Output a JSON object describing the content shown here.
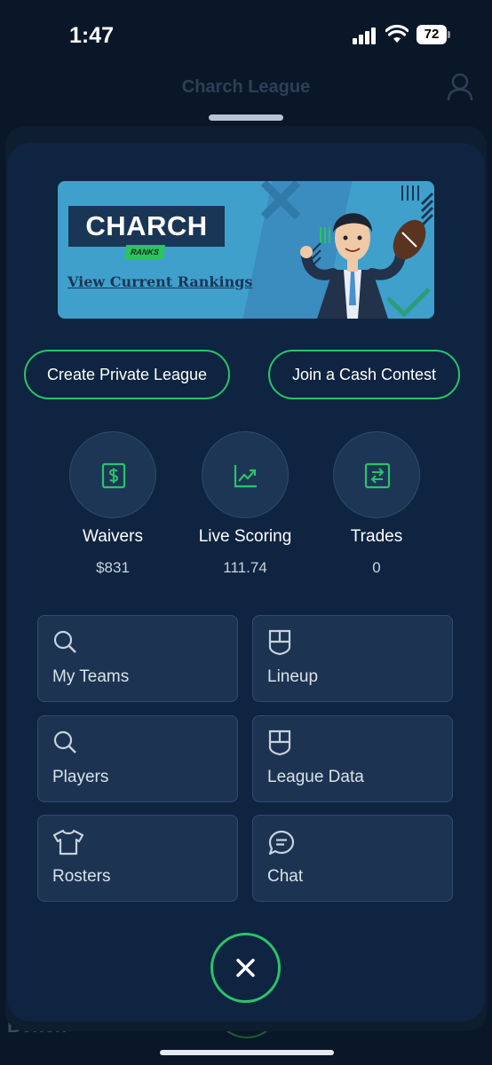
{
  "status_bar": {
    "time": "1:47",
    "battery": "72"
  },
  "background": {
    "title": "Charch League",
    "bench_label": "Bench"
  },
  "banner": {
    "title": "CHARCH",
    "badge": "RANKS",
    "link_text": "View Current Rankings"
  },
  "actions": {
    "create_league": "Create Private League",
    "join_contest": "Join a Cash Contest"
  },
  "stats": [
    {
      "label": "Waivers",
      "value": "$831",
      "icon": "dollar-icon"
    },
    {
      "label": "Live Scoring",
      "value": "111.74",
      "icon": "trending-up-icon"
    },
    {
      "label": "Trades",
      "value": "0",
      "icon": "swap-icon"
    }
  ],
  "tiles": [
    {
      "label": "My Teams",
      "icon": "search-icon"
    },
    {
      "label": "Lineup",
      "icon": "shield-icon"
    },
    {
      "label": "Players",
      "icon": "search-icon"
    },
    {
      "label": "League Data",
      "icon": "shield-icon"
    },
    {
      "label": "Rosters",
      "icon": "shirt-icon"
    },
    {
      "label": "Chat",
      "icon": "chat-icon"
    }
  ],
  "colors": {
    "accent_green": "#29c468",
    "sheet_bg": "#0e2441",
    "tile_bg": "#1c3452",
    "banner_bg": "#3fa0cc"
  }
}
